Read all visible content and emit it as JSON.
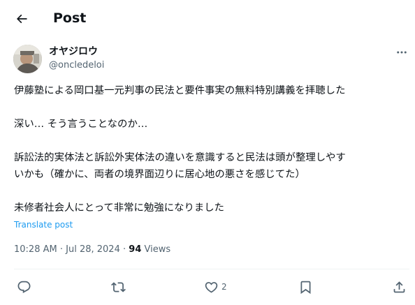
{
  "header": {
    "title": "Post"
  },
  "author": {
    "name": "オヤジロウ",
    "handle": "@oncledeloi"
  },
  "tweet": {
    "lines": [
      "伊藤塾による岡口基一元判事の民法と要件事実の無料特別講義を拝聴した",
      "",
      "深い… そう言うことなのか…",
      "",
      "訴訟法的実体法と訴訟外実体法の違いを意識すると民法は頭が整理しやす",
      "いかも（確かに、両者の境界面辺りに居心地の悪さを感じてた）",
      "",
      "未修者社会人にとって非常に勉強になりました"
    ],
    "translate_label": "Translate post"
  },
  "meta": {
    "time": "10:28 AM",
    "separator": "·",
    "date": "Jul 28, 2024",
    "views_count": "94",
    "views_label": "Views"
  },
  "actions": {
    "like_count": "2"
  },
  "icons": {
    "back": "arrow-left-icon",
    "more": "more-horizontal-icon",
    "reply": "reply-icon",
    "retweet": "retweet-icon",
    "like": "heart-icon",
    "bookmark": "bookmark-icon",
    "share": "share-icon"
  },
  "colors": {
    "text": "#0f1419",
    "secondary": "#536471",
    "link": "#1d9bf0",
    "divider": "#eff3f4"
  }
}
